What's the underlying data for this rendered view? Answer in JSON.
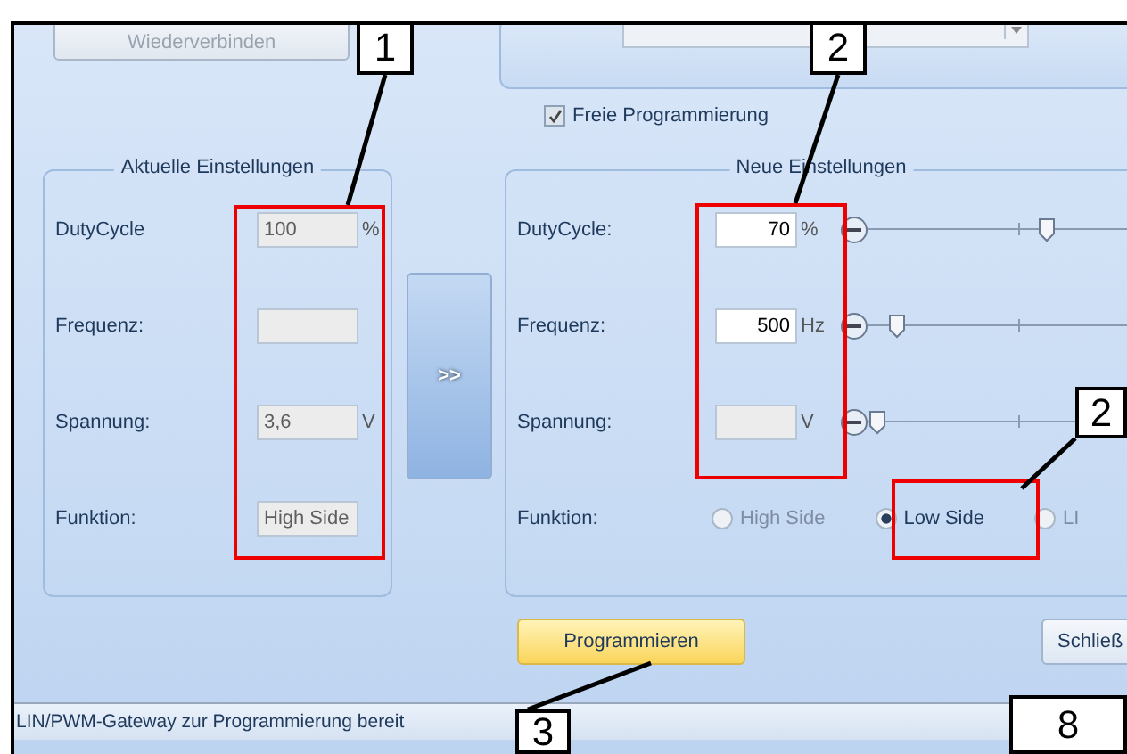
{
  "reconnect_button": {
    "label": "Wiederverbinden",
    "disabled": true
  },
  "free_programming": {
    "label": "Freie Programmierung",
    "checked": true
  },
  "current_settings": {
    "title": "Aktuelle Einstellungen",
    "rows": [
      {
        "label": "DutyCycle",
        "value": "100",
        "unit": "%",
        "disabled": true
      },
      {
        "label": "Frequenz:",
        "disabled": true
      },
      {
        "label": "Spannung:",
        "value": "3,6",
        "unit": "V",
        "disabled": true
      },
      {
        "label": "Funktion:",
        "value": "High Side",
        "disabled": true
      }
    ]
  },
  "transfer_button": {
    "label": ">>"
  },
  "new_settings": {
    "title": "Neue Einstellungen",
    "rows": [
      {
        "label": "DutyCycle:",
        "value": "70",
        "unit": "%",
        "disabled": false,
        "level": 0.63
      },
      {
        "label": "Frequenz:",
        "value": "500",
        "unit": "Hz",
        "disabled": false,
        "level": 0.07
      },
      {
        "label": "Spannung:",
        "unit": "V",
        "disabled": true,
        "level": 0.0
      }
    ],
    "function": {
      "label": "Funktion:",
      "options": [
        {
          "label": "High Side",
          "selected": false
        },
        {
          "label": "Low Side",
          "selected": true
        },
        {
          "label": "LI",
          "selected": false
        }
      ]
    }
  },
  "buttons": [
    {
      "label": "Programmieren",
      "kind": "primary"
    },
    {
      "label": "Schließ",
      "kind": "normal"
    }
  ],
  "status_bar": "LIN/PWM-Gateway zur Programmierung bereit",
  "callouts": [
    {
      "number": "1"
    },
    {
      "number": "2"
    },
    {
      "number": "2"
    },
    {
      "number": "3"
    },
    {
      "number": "8"
    }
  ]
}
